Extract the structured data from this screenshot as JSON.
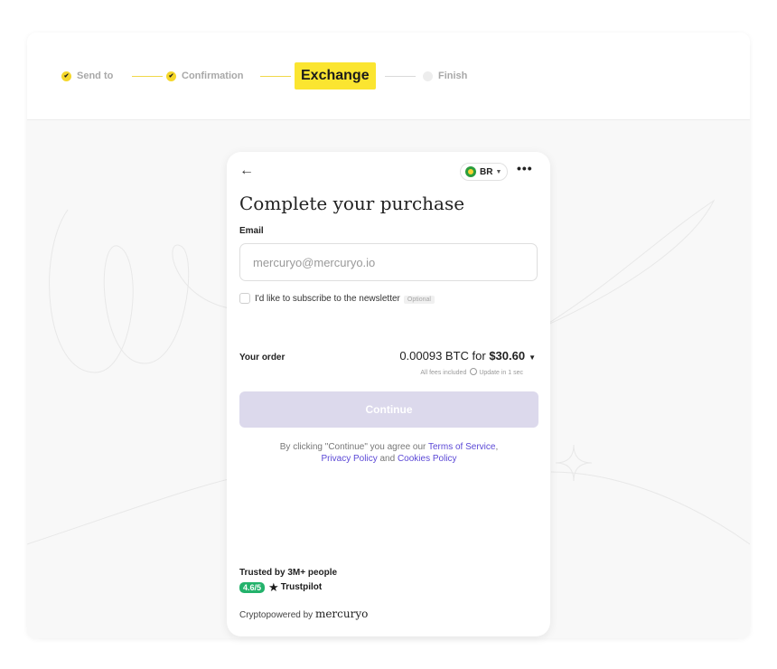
{
  "stepper": {
    "steps": [
      {
        "label": "Send to",
        "state": "done"
      },
      {
        "label": "Confirmation",
        "state": "done"
      },
      {
        "label": "Exchange",
        "state": "active"
      },
      {
        "label": "Finish",
        "state": "pending"
      }
    ]
  },
  "widget": {
    "back_icon": "←",
    "region_code": "BR",
    "more_icon": "•••",
    "title": "Complete your purchase",
    "email_label": "Email",
    "email_placeholder": "mercuryo@mercuryo.io",
    "newsletter_label": "I'd like to subscribe to the newsletter",
    "optional_badge": "Optional",
    "order_label": "Your order",
    "order_amount_prefix": "0.00093 BTC for ",
    "order_amount_price": "$30.60",
    "fees_text": "All fees included",
    "update_text": "Update in 1 sec",
    "continue_label": "Continue",
    "legal_prefix": "By clicking \"Continue\" you agree our ",
    "legal_tos": "Terms of Service",
    "legal_comma": ",",
    "legal_privacy": "Privacy Policy",
    "legal_and": " and ",
    "legal_cookies": "Cookies Policy",
    "trusted_text": "Trusted by 3M+ people",
    "trustpilot_rating": "4.6/5",
    "trustpilot_name": "Trustpilot",
    "powered_prefix": "Cryptopowered by ",
    "powered_brand": "mercuryo"
  },
  "colors": {
    "accent_yellow": "#fbe530",
    "continue_disabled": "#dcd9ec",
    "link": "#5b48d6",
    "trustpilot_green": "#23b26b"
  }
}
